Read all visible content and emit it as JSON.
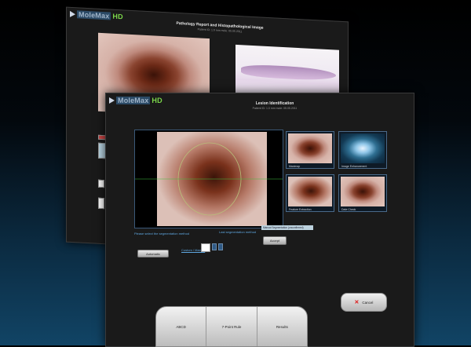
{
  "app": {
    "logo_main": "MoleMax",
    "logo_suffix": "HD"
  },
  "back_window": {
    "title": "Pathology Report and Histopathological Image",
    "subtitle": "Patient ID: 1.0 mm mole: 05.05.2011"
  },
  "front_window": {
    "title": "Lesion Identification",
    "subtitle": "Patient ID: 1.0 mm mole: 05.05.2011",
    "thumbnails": [
      {
        "label": "Maximap"
      },
      {
        "label": "Image Enhancement"
      },
      {
        "label": "Feature Extraction"
      },
      {
        "label": "Date Check"
      }
    ],
    "segmentation_prompt": "Please select the segmentation method",
    "last_method_label": "Last segmentation method",
    "last_method_value": "Manual Segmentation (unconfirmed)",
    "automatic_button": "Automatic",
    "custom_link": "Custom / Manual",
    "accept_button": "Accept",
    "cancel_button": "Cancel",
    "bottom_tabs": [
      "ABCD",
      "7-Point Rule",
      "Results"
    ]
  }
}
